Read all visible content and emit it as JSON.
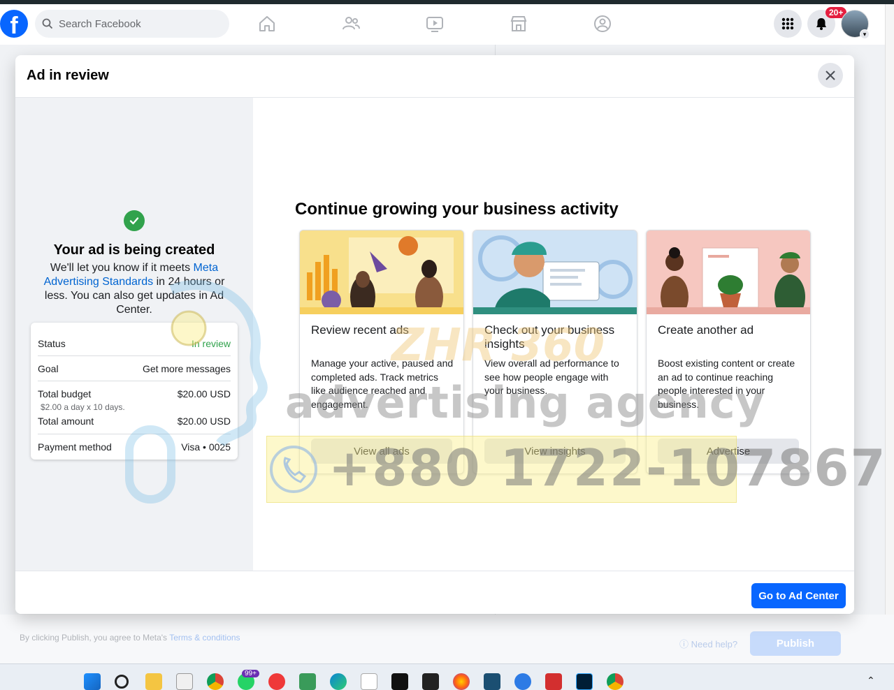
{
  "header": {
    "logo": "f",
    "search_placeholder": "Search Facebook",
    "notification_count": "20+",
    "nav_icons": [
      "home-icon",
      "friends-icon",
      "video-icon",
      "marketplace-icon",
      "groups-icon"
    ]
  },
  "background": {
    "terms_prefix": "By clicking Publish, you agree to Meta's ",
    "terms_link": "Terms & conditions",
    "need_help": "Need help?",
    "publish_label": "Publish"
  },
  "modal": {
    "title": "Ad in review",
    "left": {
      "heading": "Your ad is being created",
      "desc_before": "We'll let you know if it meets ",
      "desc_link": "Meta Advertising Standards",
      "desc_after": " in 24 hours or less. You can also get updates in Ad Center.",
      "summary": {
        "status_label": "Status",
        "status_value": "In review",
        "goal_label": "Goal",
        "goal_value": "Get more messages",
        "budget_label": "Total budget",
        "budget_value": "$20.00 USD",
        "budget_sub": "$2.00 a day x 10 days.",
        "amount_label": "Total amount",
        "amount_value": "$20.00 USD",
        "payment_label": "Payment method",
        "payment_value": "Visa • 0025"
      }
    },
    "right": {
      "heading": "Continue growing your business activity",
      "cards": [
        {
          "title": "Review recent ads",
          "desc": "Manage your active, paused and completed ads. Track metrics like audience reached and engagement.",
          "button": "View all ads"
        },
        {
          "title": "Check out your business insights",
          "desc": "View overall ad performance to see how people engage with your business.",
          "button": "View insights"
        },
        {
          "title": "Create another ad",
          "desc": "Boost existing content or create an ad to continue reaching people interested in your business.",
          "button": "Advertise"
        }
      ]
    },
    "footer_button": "Go to Ad Center"
  },
  "watermark": {
    "brand": "ZHR 360",
    "line": "advertising agency",
    "phone": "+880 1722-107867"
  },
  "taskbar": {
    "whatsapp_badge": "99+"
  },
  "colors": {
    "facebook_blue": "#0866ff",
    "success_green": "#31a24c",
    "link_blue": "#0064d1",
    "notification_red": "#e41e3f"
  }
}
